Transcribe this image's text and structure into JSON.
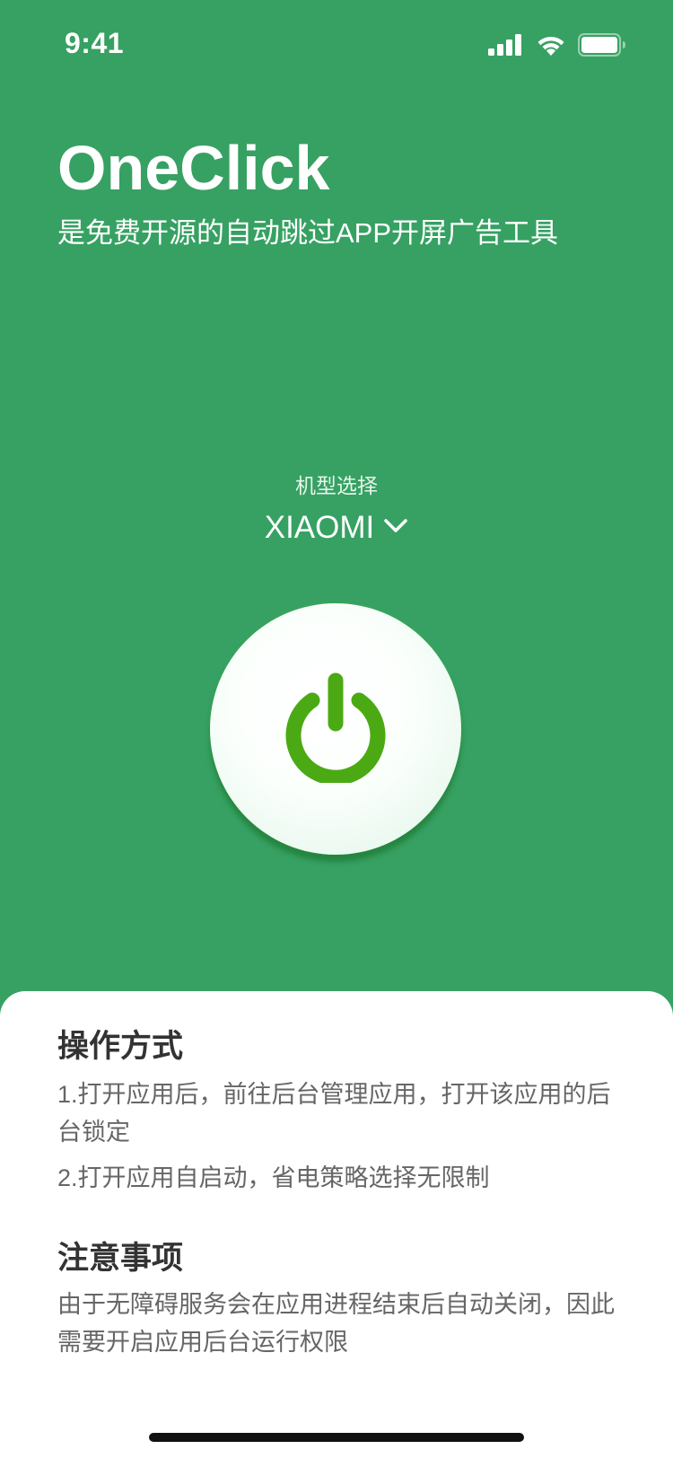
{
  "status_bar": {
    "time": "9:41",
    "signal_icon": "cellular-signal-icon",
    "wifi_icon": "wifi-icon",
    "battery_icon": "battery-icon"
  },
  "header": {
    "title": "OneClick",
    "subtitle": "是免费开源的自动跳过APP开屏广告工具"
  },
  "model_selector": {
    "label": "机型选择",
    "selected": "XIAOMI",
    "icon": "chevron-down-icon"
  },
  "power_button": {
    "icon": "power-icon"
  },
  "instructions": {
    "title": "操作方式",
    "steps": [
      "1.打开应用后，前往后台管理应用，打开该应用的后台锁定",
      "2.打开应用自启动，省电策略选择无限制"
    ]
  },
  "notes": {
    "title": "注意事项",
    "text": "由于无障碍服务会在应用进程结束后自动关闭，因此需要开启应用后台运行权限"
  },
  "colors": {
    "background_green": "#36A162",
    "power_icon_green": "#4BAA14",
    "sheet_background": "#FFFFFF",
    "heading_text": "#333333",
    "body_text": "#666666"
  }
}
